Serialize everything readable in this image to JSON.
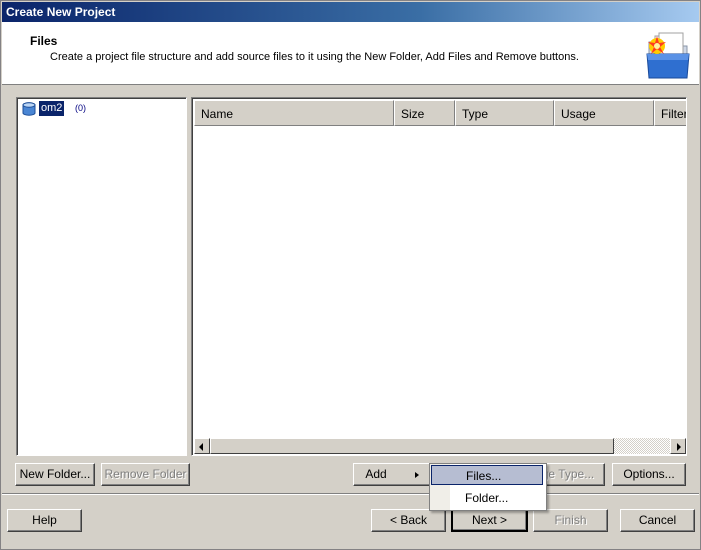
{
  "window": {
    "title": "Create New Project"
  },
  "header": {
    "title": "Files",
    "description": "Create a project file structure and add source files to it using the New Folder, Add Files and Remove buttons.",
    "icon": "project-folder-icon"
  },
  "tree": {
    "root": {
      "label": "om2",
      "count": "(0)",
      "icon": "database-icon"
    }
  },
  "file_list": {
    "columns": [
      "Name",
      "Size",
      "Type",
      "Usage",
      "Filter"
    ],
    "rows": []
  },
  "buttons": {
    "new_folder": "New Folder...",
    "remove_folder": "Remove Folder",
    "add": "Add",
    "change_type": "ge Type...",
    "options": "Options...",
    "help": "Help",
    "back": "< Back",
    "next": "Next >",
    "finish": "Finish",
    "cancel": "Cancel"
  },
  "add_menu": {
    "items": [
      "Files...",
      "Folder..."
    ],
    "selected": "Files..."
  }
}
